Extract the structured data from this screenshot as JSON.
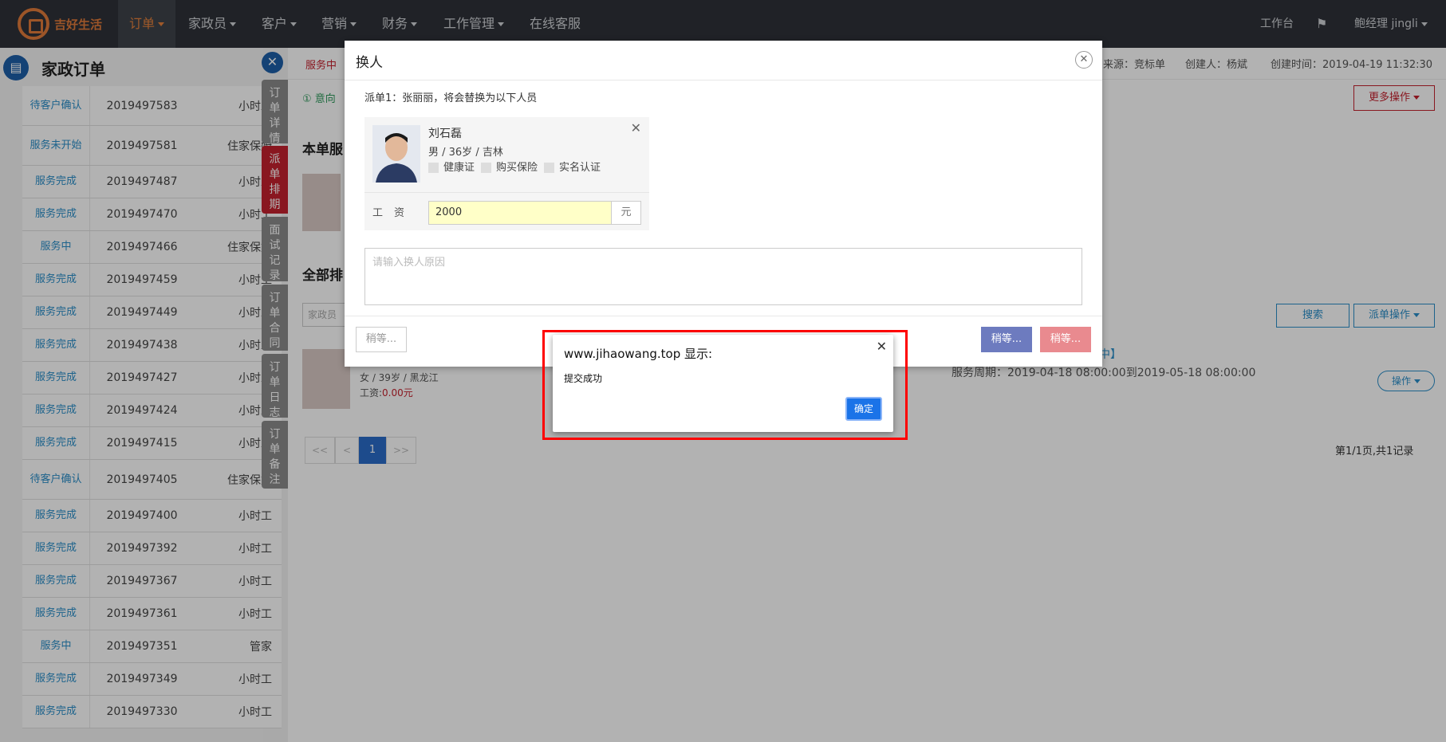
{
  "nav": {
    "logo_text": "吉好生活",
    "items": [
      {
        "label": "订单",
        "active": true
      },
      {
        "label": "家政员"
      },
      {
        "label": "客户"
      },
      {
        "label": "营销"
      },
      {
        "label": "财务"
      },
      {
        "label": "工作管理"
      },
      {
        "label": "在线客服"
      }
    ],
    "workbench": "工作台",
    "user": "鲍经理 jingli"
  },
  "left_panel": {
    "title": "家政订单",
    "rows": [
      {
        "status": "待客户确认",
        "no": "2019497583",
        "type": "小时工"
      },
      {
        "status": "服务未开始",
        "no": "2019497581",
        "type": "住家保姆"
      },
      {
        "status": "服务完成",
        "no": "2019497487",
        "type": "小时工"
      },
      {
        "status": "服务完成",
        "no": "2019497470",
        "type": "小时工"
      },
      {
        "status": "服务中",
        "no": "2019497466",
        "type": "住家保姆"
      },
      {
        "status": "服务完成",
        "no": "2019497459",
        "type": "小时工"
      },
      {
        "status": "服务完成",
        "no": "2019497449",
        "type": "小时工"
      },
      {
        "status": "服务完成",
        "no": "2019497438",
        "type": "小时工"
      },
      {
        "status": "服务完成",
        "no": "2019497427",
        "type": "小时工"
      },
      {
        "status": "服务完成",
        "no": "2019497424",
        "type": "小时工"
      },
      {
        "status": "服务完成",
        "no": "2019497415",
        "type": "小时工"
      },
      {
        "status": "待客户确认",
        "no": "2019497405",
        "type": "住家保姆"
      },
      {
        "status": "服务完成",
        "no": "2019497400",
        "type": "小时工"
      },
      {
        "status": "服务完成",
        "no": "2019497392",
        "type": "小时工"
      },
      {
        "status": "服务完成",
        "no": "2019497367",
        "type": "小时工"
      },
      {
        "status": "服务完成",
        "no": "2019497361",
        "type": "小时工"
      },
      {
        "status": "服务中",
        "no": "2019497351",
        "type": "管家"
      },
      {
        "status": "服务完成",
        "no": "2019497349",
        "type": "小时工"
      },
      {
        "status": "服务完成",
        "no": "2019497330",
        "type": "小时工"
      }
    ]
  },
  "side_tabs": [
    {
      "label": "订单详情"
    },
    {
      "label": "派单排期",
      "active": true
    },
    {
      "label": "面试记录"
    },
    {
      "label": "订单合同"
    },
    {
      "label": "订单日志"
    },
    {
      "label": "订单备注"
    }
  ],
  "main": {
    "status_tag": "服务中",
    "source": "来源：竞标单",
    "creator": "创建人：杨斌",
    "created": "创建时间：2019-04-19 11:32:30",
    "intent_note": "意向",
    "more_ops": "更多操作",
    "section1": "本单服",
    "section2": "全部排",
    "filter_placeholder": "家政员",
    "search_btn": "搜索",
    "dispatch_ops": "派单操作",
    "worker_info": "女 / 39岁 / 黑龙江",
    "worker_salary_label": "工资:",
    "worker_salary": "0.00元",
    "service_status": "务中】",
    "service_period": "服务周期：2019-04-18 08:00:00到2019-05-18 08:00:00",
    "op_btn": "操作",
    "pager": [
      "<<",
      "<",
      "1",
      ">>"
    ],
    "page_info": "第1/1页,共1记录"
  },
  "modal": {
    "title": "换人",
    "note": "派单1：张丽丽，将会替换为以下人员",
    "person": {
      "name": "刘石磊",
      "info": "男 / 36岁 / 吉林",
      "checks": [
        "健康证",
        "购买保险",
        "实名认证"
      ]
    },
    "salary_label": "工资",
    "salary_value": "2000",
    "salary_unit": "元",
    "reason_placeholder": "请输入换人原因",
    "btn_left": "稍等...",
    "btn_blue": "稍等...",
    "btn_red": "稍等..."
  },
  "alert": {
    "title": "www.jihaowang.top 显示:",
    "message": "提交成功",
    "ok": "确定"
  },
  "colors": {
    "brand": "#e07a3a",
    "link": "#2a8ec9",
    "danger": "#c4222e",
    "ok_button": "#1a73e8",
    "highlight_frame": "#ff0000"
  }
}
